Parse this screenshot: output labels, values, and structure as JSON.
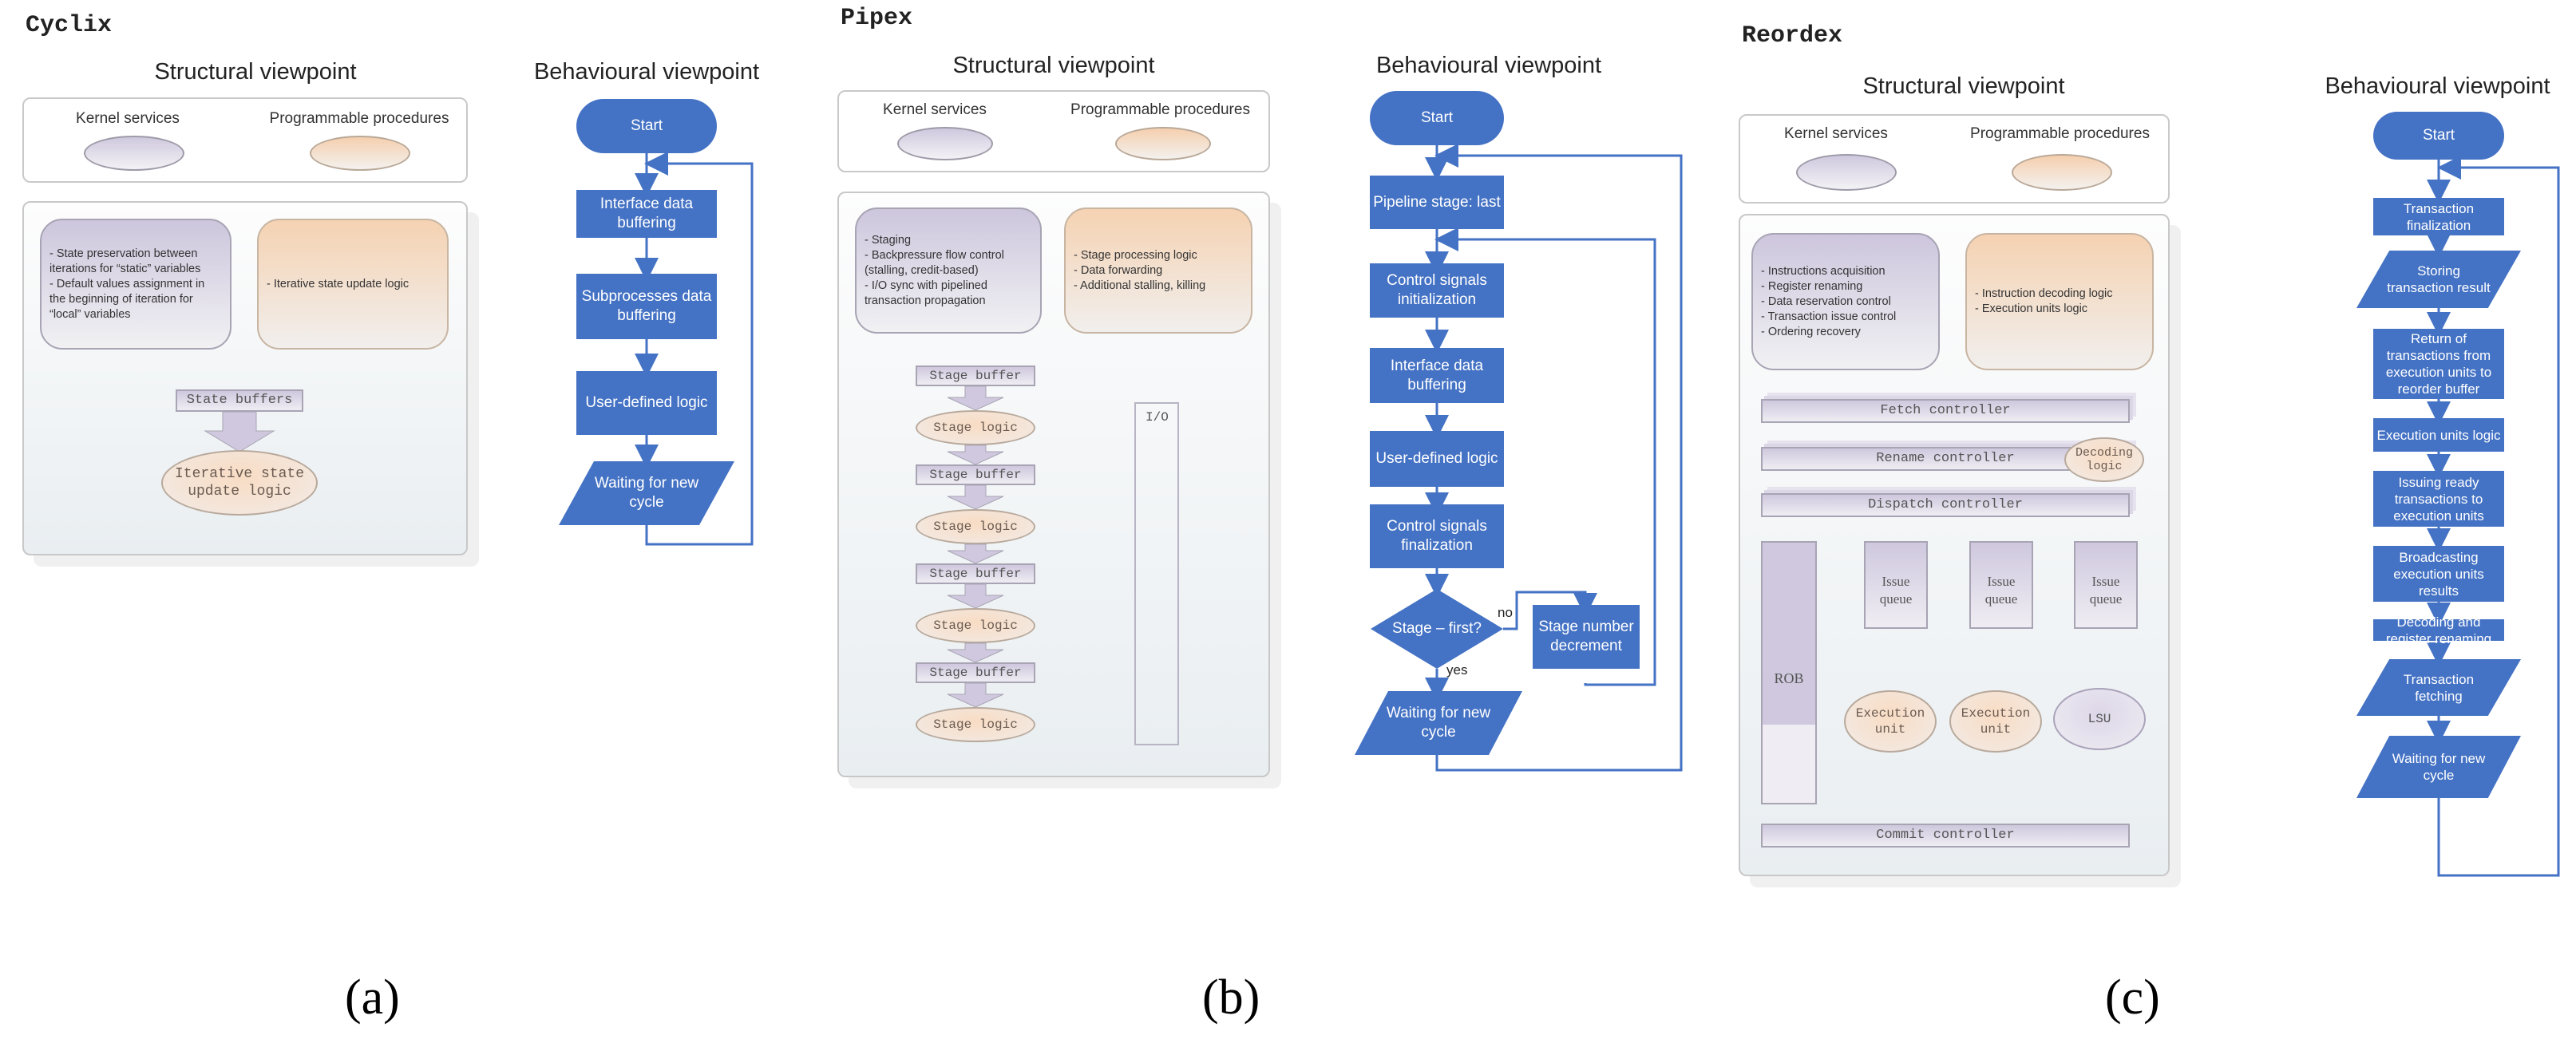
{
  "captions": [
    "(a)",
    "(b)",
    "(c)"
  ],
  "colors": {
    "flowchart_blue": "#4472c4",
    "connector_blue": "#6d95d8",
    "kernel_purple": "#cdc6dd",
    "programmable_peach": "#f5d2b2",
    "signal_purple": "#5b4a8a"
  },
  "legend": {
    "kernel_label": "Kernel services",
    "programmable_label": "Programmable procedures"
  },
  "viewpoints": {
    "structural": "Structural viewpoint",
    "behavioural": "Behavioural viewpoint"
  },
  "cyclix": {
    "name": "Cyclix",
    "kernel_items": [
      "- State preservation between iterations for “static” variables",
      "- Default values assignment in the beginning of iteration for “local” variables"
    ],
    "programmable_items": [
      "- Iterative state update logic"
    ],
    "state_buffers": "State buffers",
    "logic_cloud": "Iterative state update logic",
    "flow": {
      "start": "Start",
      "steps": [
        "Interface data buffering",
        "Subprocesses data buffering",
        "User-defined logic"
      ],
      "wait": "Waiting for new cycle"
    }
  },
  "pipex": {
    "name": "Pipex",
    "kernel_items": [
      "- Staging",
      "- Backpressure flow control (stalling, credit-based)",
      "- I/O sync with pipelined transaction propagation"
    ],
    "programmable_items": [
      "- Stage processing logic",
      "- Data forwarding",
      "- Additional stalling, killing"
    ],
    "stage_buffer": "Stage buffer",
    "stage_logic": "Stage logic",
    "io_label": "I/O",
    "flow": {
      "start": "Start",
      "steps": [
        "Pipeline stage: last",
        "Control signals initialization",
        "Interface data buffering",
        "User-defined logic",
        "Control signals finalization"
      ],
      "decision": "Stage – first?",
      "no_label": "no",
      "yes_label": "yes",
      "decrement": "Stage number decrement",
      "wait": "Waiting for new cycle"
    }
  },
  "reordex": {
    "name": "Reordex",
    "kernel_items": [
      "- Instructions acquisition",
      "- Register renaming",
      "- Data reservation control",
      "- Transaction issue control",
      "- Ordering recovery"
    ],
    "programmable_items": [
      "- Instruction decoding logic",
      "- Execution units logic"
    ],
    "fetch": "Fetch controller",
    "rename": "Rename controller",
    "decoding": "Decoding logic",
    "dispatch": "Dispatch controller",
    "rob": "ROB",
    "issue_queue": "Issue queue",
    "exec_unit": "Execution unit",
    "lsu": "LSU",
    "commit": "Commit controller",
    "flow": {
      "start": "Start",
      "steps": [
        {
          "text": "Transaction finalization",
          "shape": "process"
        },
        {
          "text": "Storing transaction result",
          "shape": "io"
        },
        {
          "text": "Return of transactions from execution units to reorder buffer",
          "shape": "process"
        },
        {
          "text": "Execution units logic",
          "shape": "process"
        },
        {
          "text": "Issuing ready transactions to execution units",
          "shape": "process"
        },
        {
          "text": "Broadcasting execution units results",
          "shape": "process"
        },
        {
          "text": "Decoding and register renaming",
          "shape": "process"
        },
        {
          "text": "Transaction fetching",
          "shape": "io"
        }
      ],
      "wait": "Waiting for new cycle"
    }
  }
}
